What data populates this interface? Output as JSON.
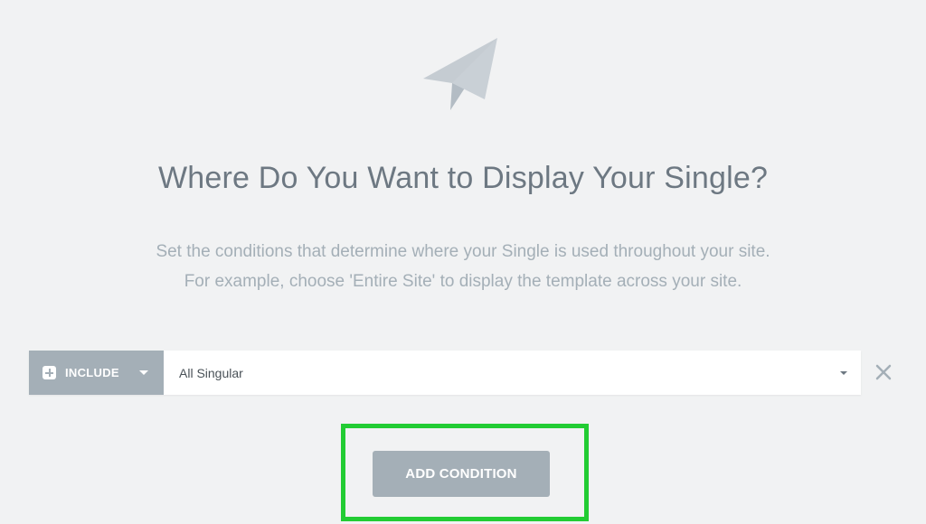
{
  "hero": {
    "icon": "paper-plane-icon"
  },
  "heading": {
    "title": "Where Do You Want to Display Your Single?",
    "subtitle_line1": "Set the conditions that determine where your Single is used throughout your site.",
    "subtitle_line2": "For example, choose 'Entire Site' to display the template across your site."
  },
  "condition": {
    "type_icon": "plus-square-icon",
    "type_label": "INCLUDE",
    "type_dropdown_icon": "caret-down-icon",
    "value": "All Singular",
    "value_dropdown_icon": "caret-down-icon",
    "remove_icon": "close-icon"
  },
  "actions": {
    "add_condition_label": "ADD CONDITION",
    "highlight_color": "#22cc33"
  },
  "colors": {
    "background": "#f1f2f3",
    "accent_gray": "#a4afb7",
    "title_text": "#6d7882"
  }
}
